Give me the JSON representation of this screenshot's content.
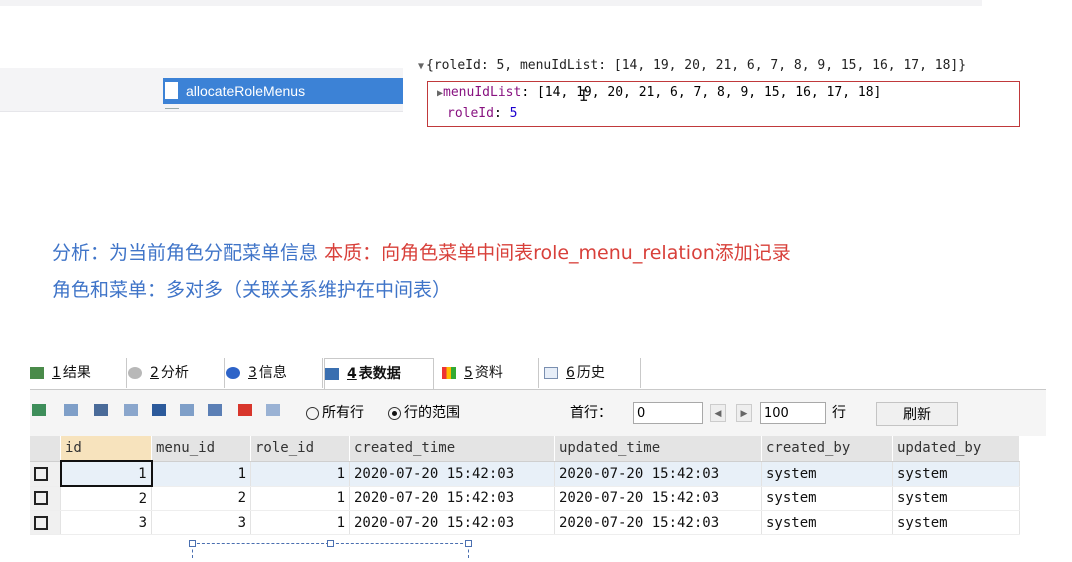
{
  "method_item": {
    "label": "allocateRoleMenus"
  },
  "console": {
    "summary": "{roleId: 5, menuIdList: [14, 19, 20, 21, 6, 7, 8, 9, 15, 16, 17, 18]}",
    "menuIdList_key": "menuIdList",
    "menuIdList_value": "[14, 19, 20, 21, 6, 7, 8, 9, 15, 16, 17, 18]",
    "roleId_key": "roleId",
    "roleId_value": "5",
    "colors": {
      "key": "#881280",
      "number": "#1c00cf",
      "highlight_box": "#c0393b"
    }
  },
  "notes": {
    "line1_blue": "分析：为当前角色分配菜单信息",
    "line1_red": "本质：向角色菜单中间表role_menu_relation添加记录",
    "line2": "角色和菜单：多对多（关联关系维护在中间表）",
    "colors": {
      "blue": "#3f74c8",
      "red": "#d8403a"
    }
  },
  "tabs": [
    {
      "num": "1",
      "label": "结果",
      "icon": "result-grid-icon"
    },
    {
      "num": "2",
      "label": "分析",
      "icon": "profiler-icon"
    },
    {
      "num": "3",
      "label": "信息",
      "icon": "info-icon"
    },
    {
      "num": "4",
      "label": "表数据",
      "icon": "table-data-icon",
      "active": true
    },
    {
      "num": "5",
      "label": "资料",
      "icon": "chart-icon"
    },
    {
      "num": "6",
      "label": "历史",
      "icon": "calendar-history-icon"
    }
  ],
  "toolbar": {
    "radio_all": "所有行",
    "radio_range": "行的范围",
    "selected_radio": "行的范围",
    "first_row_label": "首行：",
    "first_row_value": "0",
    "row_count_value": "100",
    "row_unit": "行",
    "refresh_label": "刷新"
  },
  "grid": {
    "columns": [
      "id",
      "menu_id",
      "role_id",
      "created_time",
      "updated_time",
      "created_by",
      "updated_by"
    ],
    "sorted_column": "id",
    "rows": [
      [
        "1",
        "1",
        "1",
        "2020-07-20 15:42:03",
        "2020-07-20 15:42:03",
        "system",
        "system"
      ],
      [
        "2",
        "2",
        "1",
        "2020-07-20 15:42:03",
        "2020-07-20 15:42:03",
        "system",
        "system"
      ],
      [
        "3",
        "3",
        "1",
        "2020-07-20 15:42:03",
        "2020-07-20 15:42:03",
        "system",
        "system"
      ]
    ]
  }
}
